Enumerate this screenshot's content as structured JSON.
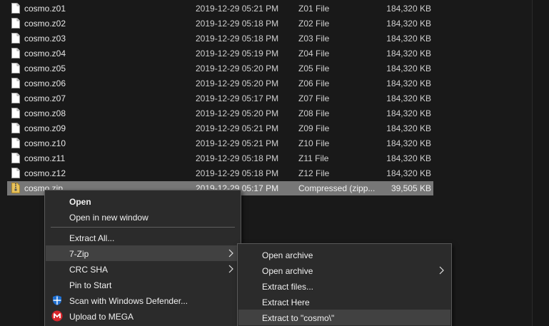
{
  "files": [
    {
      "name": "cosmo.z01",
      "date": "2019-12-29 05:21 PM",
      "type": "Z01 File",
      "size": "184,320 KB"
    },
    {
      "name": "cosmo.z02",
      "date": "2019-12-29 05:18 PM",
      "type": "Z02 File",
      "size": "184,320 KB"
    },
    {
      "name": "cosmo.z03",
      "date": "2019-12-29 05:18 PM",
      "type": "Z03 File",
      "size": "184,320 KB"
    },
    {
      "name": "cosmo.z04",
      "date": "2019-12-29 05:19 PM",
      "type": "Z04 File",
      "size": "184,320 KB"
    },
    {
      "name": "cosmo.z05",
      "date": "2019-12-29 05:20 PM",
      "type": "Z05 File",
      "size": "184,320 KB"
    },
    {
      "name": "cosmo.z06",
      "date": "2019-12-29 05:20 PM",
      "type": "Z06 File",
      "size": "184,320 KB"
    },
    {
      "name": "cosmo.z07",
      "date": "2019-12-29 05:17 PM",
      "type": "Z07 File",
      "size": "184,320 KB"
    },
    {
      "name": "cosmo.z08",
      "date": "2019-12-29 05:20 PM",
      "type": "Z08 File",
      "size": "184,320 KB"
    },
    {
      "name": "cosmo.z09",
      "date": "2019-12-29 05:21 PM",
      "type": "Z09 File",
      "size": "184,320 KB"
    },
    {
      "name": "cosmo.z10",
      "date": "2019-12-29 05:21 PM",
      "type": "Z10 File",
      "size": "184,320 KB"
    },
    {
      "name": "cosmo.z11",
      "date": "2019-12-29 05:18 PM",
      "type": "Z11 File",
      "size": "184,320 KB"
    },
    {
      "name": "cosmo.z12",
      "date": "2019-12-29 05:18 PM",
      "type": "Z12 File",
      "size": "184,320 KB"
    },
    {
      "name": "cosmo.zip",
      "date": "2019-12-29 05:17 PM",
      "type": "Compressed (zipp...",
      "size": "39,505 KB",
      "icon": "zip-folder-icon",
      "selected": true
    }
  ],
  "context_menu": {
    "open": "Open",
    "open_new_window": "Open in new window",
    "extract_all": "Extract All...",
    "seven_zip": "7-Zip",
    "crc_sha": "CRC SHA",
    "pin_to_start": "Pin to Start",
    "scan_defender": "Scan with Windows Defender...",
    "upload_mega": "Upload to MEGA",
    "icons": {
      "defender": "windows-defender-shield-icon",
      "mega": "mega-logo-icon",
      "submenu": "chevron-right-icon"
    }
  },
  "submenu_7zip": {
    "open_archive": "Open archive",
    "open_archive_more": "Open archive",
    "extract_files": "Extract files...",
    "extract_here": "Extract Here",
    "extract_to": "Extract to \"cosmo\\\""
  },
  "colors": {
    "background": "#191919",
    "selected_row": "#777777",
    "menu_bg": "#2b2b2b",
    "menu_hover": "#414141",
    "defender_blue": "#1f6fd0",
    "mega_red": "#d9272e"
  }
}
